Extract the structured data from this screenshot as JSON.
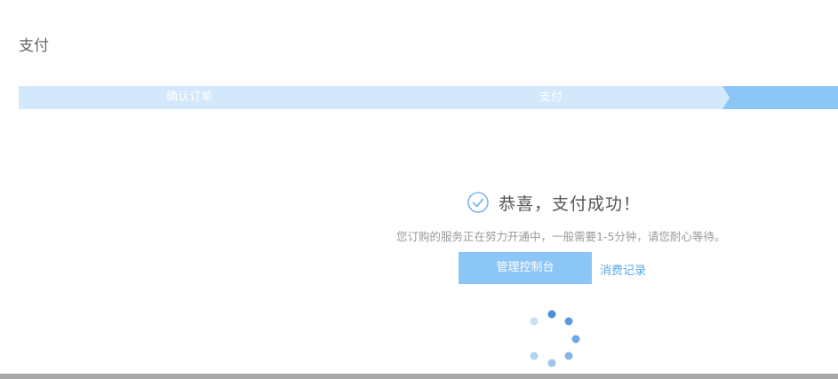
{
  "page": {
    "title": "支付"
  },
  "steps": [
    {
      "label": "确认订单",
      "state": "done"
    },
    {
      "label": "支付",
      "state": "done"
    },
    {
      "label": "",
      "state": "current"
    }
  ],
  "result": {
    "icon": "check-circle-icon",
    "title": "恭喜，支付成功！",
    "description": "您订购的服务正在努力开通中，一般需要1-5分钟，请您耐心等待。"
  },
  "actions": {
    "console_label": "管理控制台",
    "records_label": "消费记录"
  },
  "loading": {
    "icon": "loading-spinner-icon"
  },
  "colors": {
    "step_done": "#d3e8fb",
    "step_current": "#8cc6f7",
    "primary_button": "#8cc6f7",
    "link": "#5aa8e8",
    "success_icon": "#7ab6ec"
  }
}
